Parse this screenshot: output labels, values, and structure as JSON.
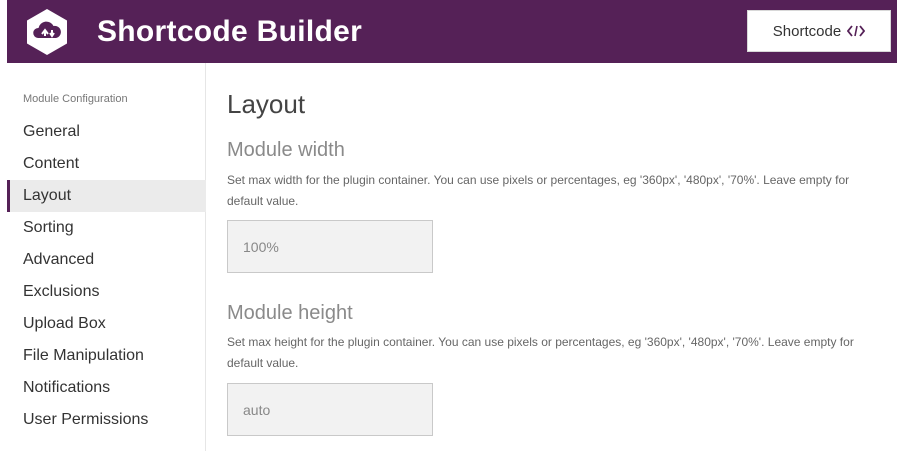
{
  "header": {
    "title": "Shortcode Builder",
    "shortcode_button_label": "Shortcode",
    "brand_color": "#552157"
  },
  "sidebar": {
    "heading": "Module Configuration",
    "items": [
      {
        "label": "General"
      },
      {
        "label": "Content"
      },
      {
        "label": "Layout",
        "active": true
      },
      {
        "label": "Sorting"
      },
      {
        "label": "Advanced"
      },
      {
        "label": "Exclusions"
      },
      {
        "label": "Upload Box"
      },
      {
        "label": "File Manipulation"
      },
      {
        "label": "Notifications"
      },
      {
        "label": "User Permissions"
      }
    ]
  },
  "main": {
    "title": "Layout",
    "module_width": {
      "label": "Module width",
      "description": "Set max width for the plugin container. You can use pixels or percentages, eg '360px', '480px', '70%'. Leave empty for default value.",
      "value": "100%"
    },
    "module_height": {
      "label": "Module height",
      "description": "Set max height for the plugin container. You can use pixels or percentages, eg '360px', '480px', '70%'. Leave empty for default value.",
      "value": "auto"
    }
  }
}
